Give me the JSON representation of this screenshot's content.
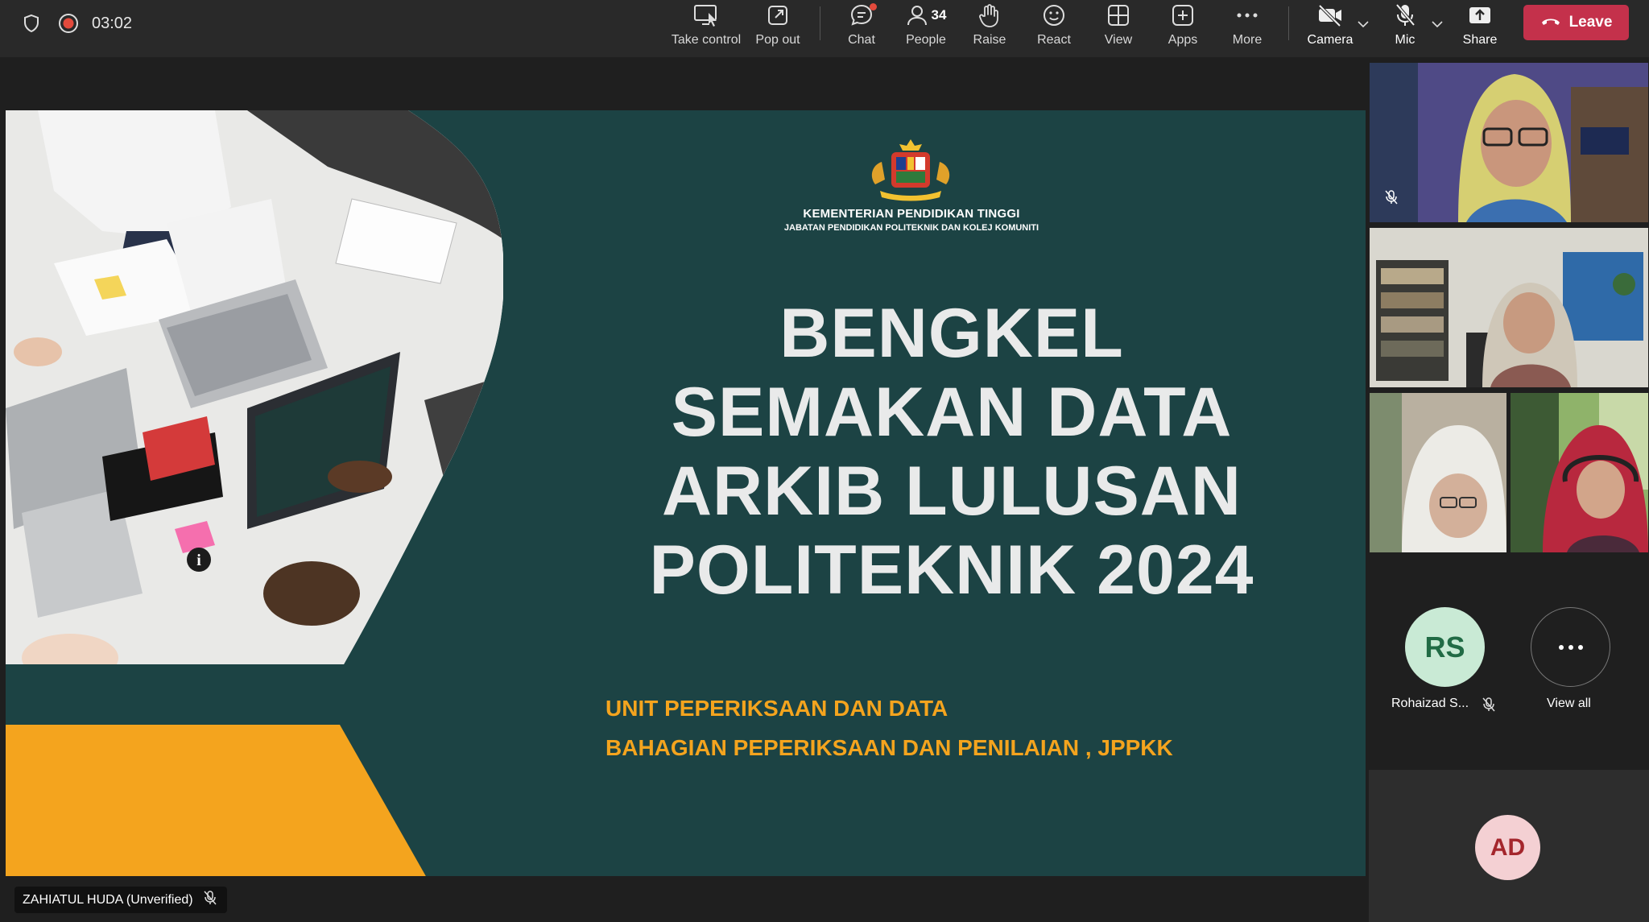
{
  "meeting": {
    "timer": "03:02"
  },
  "toolbar": {
    "take_control": "Take control",
    "pop_out": "Pop out",
    "chat": "Chat",
    "people": "People",
    "people_count": "34",
    "raise": "Raise",
    "react": "React",
    "view": "View",
    "apps": "Apps",
    "more": "More",
    "camera": "Camera",
    "mic": "Mic",
    "share": "Share",
    "leave": "Leave"
  },
  "slide": {
    "ministry_line1": "KEMENTERIAN PENDIDIKAN TINGGI",
    "ministry_line2": "JABATAN PENDIDIKAN POLITEKNIK DAN KOLEJ KOMUNITI",
    "title_lines": [
      "BENGKEL",
      "SEMAKAN DATA",
      "ARKIB LULUSAN",
      "POLITEKNIK 2024"
    ],
    "subtitle1": "UNIT PEPERIKSAAN DAN DATA",
    "subtitle2": "BAHAGIAN PEPERIKSAAN DAN PENILAIAN , JPPKK"
  },
  "presenter": {
    "name": "ZAHIATUL HUDA (Unverified)"
  },
  "participants": {
    "rs_initials": "RS",
    "rs_name": "Rohaizad S...",
    "view_all": "View all",
    "ad_initials": "AD"
  },
  "colors": {
    "slide_bg": "#1c4344",
    "accent_orange": "#f4a41e",
    "leave_red": "#c4314b",
    "selected_border": "#7f85f5"
  }
}
